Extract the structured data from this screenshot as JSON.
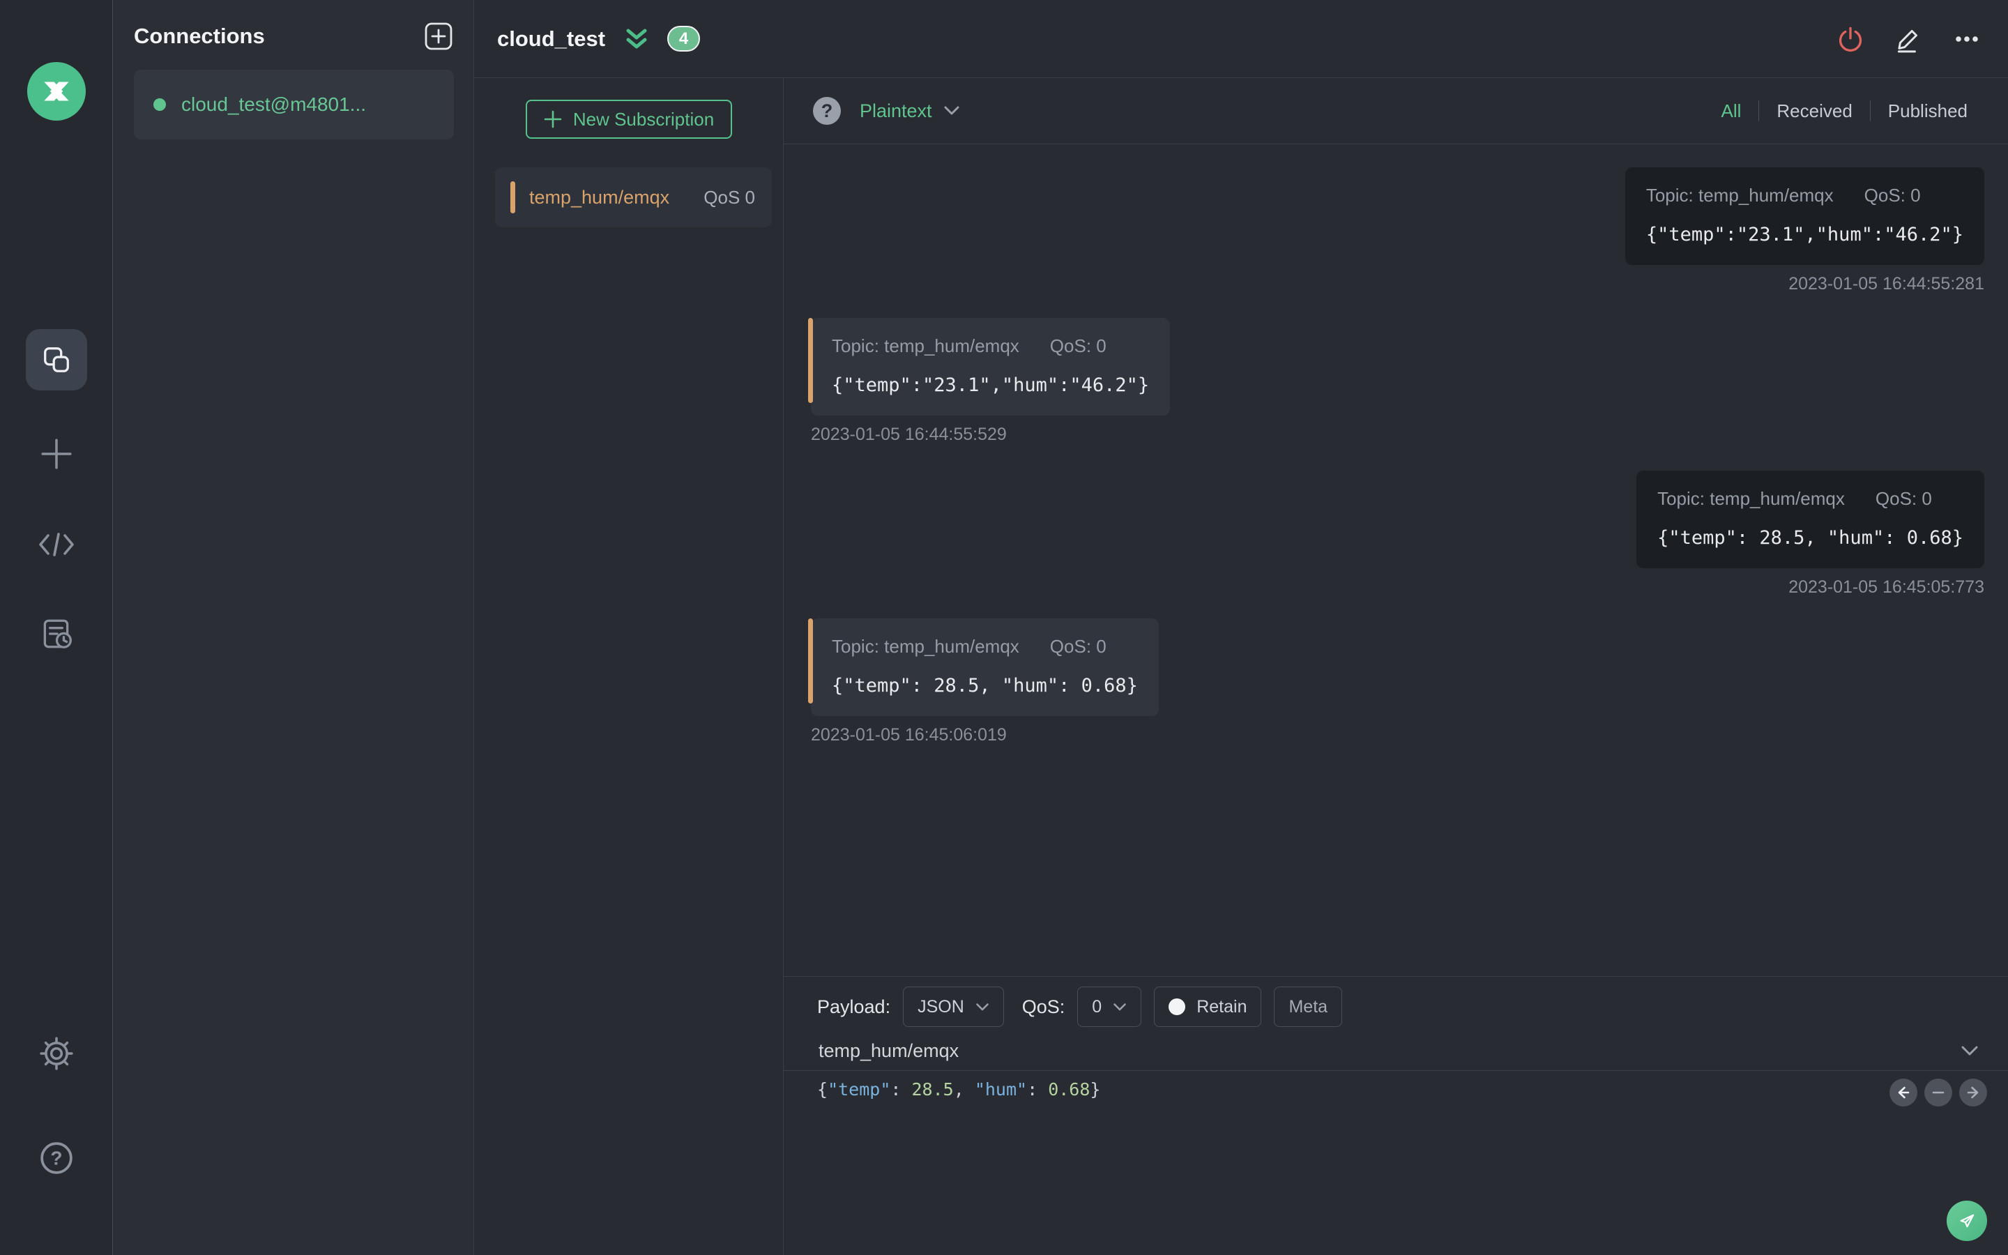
{
  "app": {
    "name": "MQTTX"
  },
  "colors": {
    "accent_green": "#5fc48e",
    "accent_orange": "#d9a36b",
    "danger_red": "#e0645e"
  },
  "connections": {
    "title": "Connections",
    "item": {
      "name": "cloud_test@m4801...",
      "status": "connected"
    }
  },
  "header": {
    "title": "cloud_test",
    "message_count": "4"
  },
  "subscriptions": {
    "new_button_label": "New Subscription",
    "items": [
      {
        "topic": "temp_hum/emqx",
        "qos": "QoS 0"
      }
    ]
  },
  "messages": {
    "view_mode": "Plaintext",
    "help_glyph": "?",
    "filters": {
      "all": "All",
      "received": "Received",
      "published": "Published",
      "active": "All"
    },
    "items": [
      {
        "direction": "published",
        "topic": "Topic: temp_hum/emqx",
        "qos": "QoS: 0",
        "payload": "{\"temp\":\"23.1\",\"hum\":\"46.2\"}",
        "timestamp": "2023-01-05 16:44:55:281"
      },
      {
        "direction": "received",
        "topic": "Topic: temp_hum/emqx",
        "qos": "QoS: 0",
        "payload": "{\"temp\":\"23.1\",\"hum\":\"46.2\"}",
        "timestamp": "2023-01-05 16:44:55:529"
      },
      {
        "direction": "published",
        "topic": "Topic: temp_hum/emqx",
        "qos": "QoS: 0",
        "payload": "{\"temp\": 28.5, \"hum\": 0.68}",
        "timestamp": "2023-01-05 16:45:05:773"
      },
      {
        "direction": "received",
        "topic": "Topic: temp_hum/emqx",
        "qos": "QoS: 0",
        "payload": "{\"temp\": 28.5, \"hum\": 0.68}",
        "timestamp": "2023-01-05 16:45:06:019"
      }
    ]
  },
  "publish": {
    "payload_label": "Payload:",
    "format_value": "JSON",
    "qos_label": "QoS:",
    "qos_value": "0",
    "retain_label": "Retain",
    "meta_label": "Meta",
    "topic_value": "temp_hum/emqx",
    "editor_parts": {
      "p0": "{",
      "k1": "\"temp\"",
      "c1": ": ",
      "v1": "28.5",
      "s1": ", ",
      "k2": "\"hum\"",
      "c2": ": ",
      "v2": "0.68",
      "p1": "}"
    }
  }
}
